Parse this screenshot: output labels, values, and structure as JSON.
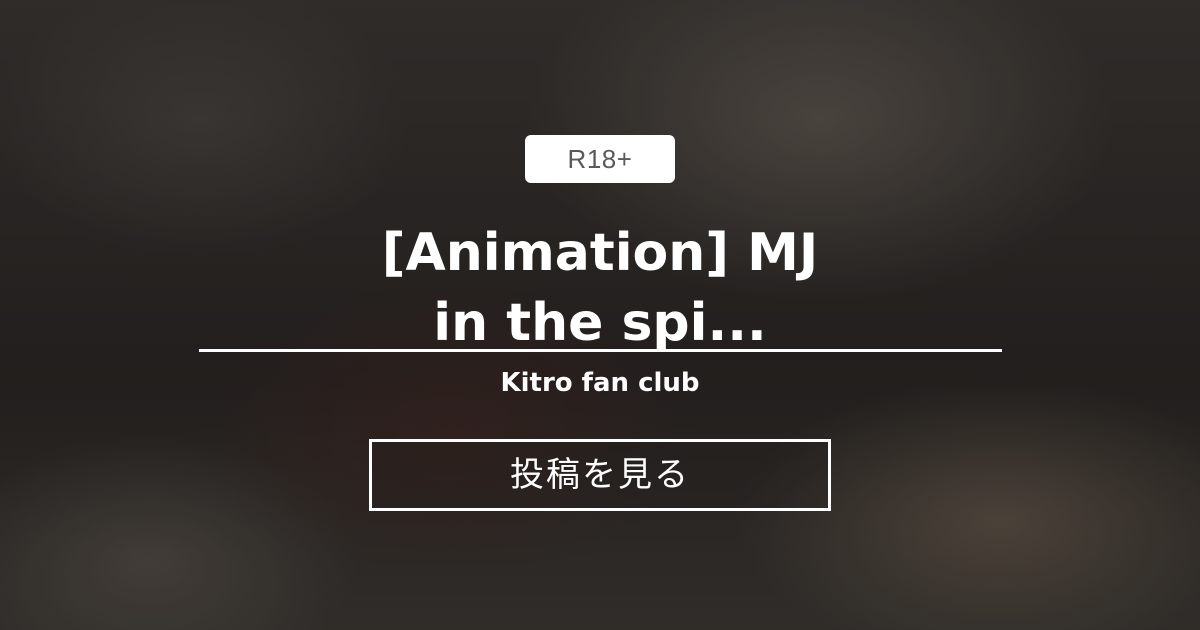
{
  "badge": {
    "label": "R18+"
  },
  "post": {
    "title_line1": "[Animation] MJ",
    "title_line2": "in the spi..."
  },
  "creator": {
    "name": "Kitro fan club"
  },
  "action": {
    "view_label": "投稿を見る"
  },
  "colors": {
    "text": "#ffffff",
    "badge_bg": "#ffffff",
    "badge_text": "#5a5a5a"
  }
}
